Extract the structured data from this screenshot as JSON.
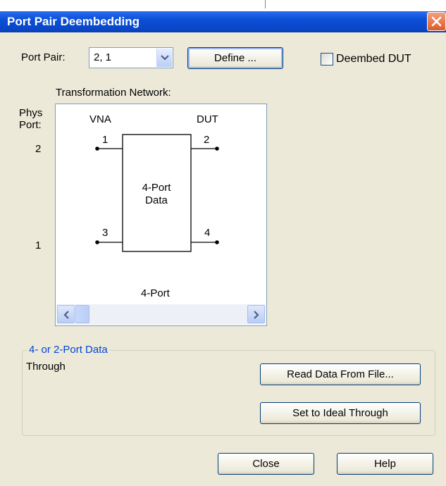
{
  "window": {
    "title": "Port Pair Deembedding"
  },
  "port_pair": {
    "label": "Port Pair:",
    "value": "2, 1",
    "define_label": "Define ..."
  },
  "deembed": {
    "label": "Deembed DUT",
    "checked": false
  },
  "network": {
    "title": "Transformation Network:",
    "phys_port_label": "Phys\nPort:",
    "phys_port_top": "2",
    "phys_port_bottom": "1",
    "vna_label": "VNA",
    "dut_label": "DUT",
    "block_label": "4-Port\nData",
    "pin1": "1",
    "pin2": "2",
    "pin3": "3",
    "pin4": "4",
    "type_label": "4-Port"
  },
  "data_group": {
    "legend": "4- or 2-Port Data",
    "status": "Through",
    "read_label": "Read Data From File...",
    "ideal_label": "Set to Ideal Through"
  },
  "footer": {
    "close_label": "Close",
    "help_label": "Help"
  }
}
